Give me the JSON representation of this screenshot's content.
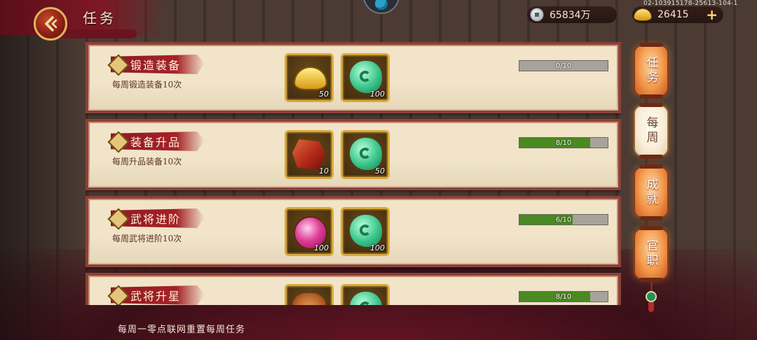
{
  "header": {
    "title": "任务",
    "silver": "65834万",
    "gold": "26415",
    "server_id": "02-103915178-25613-104-1"
  },
  "tasks": [
    {
      "title": "锻造装备",
      "desc": "每周锻造装备10次",
      "rewards": [
        {
          "icon": "gold-ingot-icon",
          "count": "50"
        },
        {
          "icon": "jade-icon",
          "count": "100"
        }
      ],
      "progress_text": "0/10",
      "progress": 0.0
    },
    {
      "title": "装备升品",
      "desc": "每周升品装备10次",
      "rewards": [
        {
          "icon": "ore-icon",
          "count": "10"
        },
        {
          "icon": "jade-icon",
          "count": "50"
        }
      ],
      "progress_text": "8/10",
      "progress": 0.8
    },
    {
      "title": "武将进阶",
      "desc": "每周武将进阶10次",
      "rewards": [
        {
          "icon": "orb-icon",
          "count": "100"
        },
        {
          "icon": "jade-icon",
          "count": "100"
        }
      ],
      "progress_text": "6/10",
      "progress": 0.6
    },
    {
      "title": "武将升星",
      "desc": "",
      "rewards": [
        {
          "icon": "star-item-icon",
          "count": ""
        },
        {
          "icon": "jade-icon",
          "count": ""
        }
      ],
      "progress_text": "8/10",
      "progress": 0.8
    }
  ],
  "footer_note": "每周一零点联网重置每周任务",
  "side_tabs": [
    {
      "label": "任务",
      "active": false
    },
    {
      "label": "每周",
      "active": true
    },
    {
      "label": "成就",
      "active": false
    },
    {
      "label": "官职",
      "active": false
    }
  ],
  "colors": {
    "progress_fill": "#4a8a22",
    "card_bg": "#f1e4c8",
    "card_border": "#8a4238",
    "title_ribbon": "#a52228"
  }
}
